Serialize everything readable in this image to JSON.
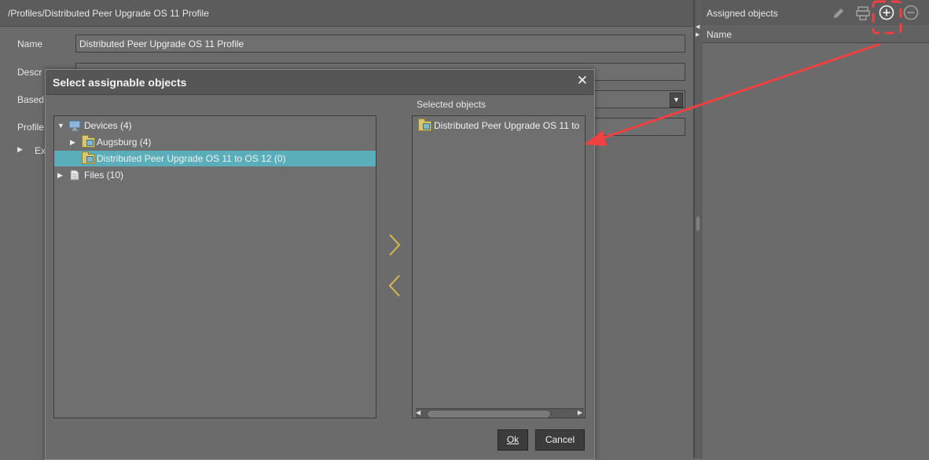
{
  "main": {
    "breadcrumb": "/Profiles/Distributed Peer Upgrade OS 11 Profile",
    "name_label": "Name",
    "name_value": "Distributed Peer Upgrade OS 11 Profile",
    "desc_label": "Descr",
    "based_label": "Based",
    "profile_label": "Profile",
    "extra_label": "Ex"
  },
  "side": {
    "title": "Assigned objects",
    "column_name": "Name",
    "tools": [
      "pencil-icon",
      "printer-icon",
      "plus-circle-icon",
      "minus-circle-icon"
    ]
  },
  "dialog": {
    "title": "Select assignable objects",
    "close": "✕",
    "tree": [
      {
        "label": "Devices (4)",
        "expanded": true
      },
      {
        "label": "Augsburg (4)",
        "expanded": false
      },
      {
        "label": "Distributed Peer Upgrade OS 11 to OS 12  (0)",
        "selected": true
      },
      {
        "label": "Files (10)",
        "expanded": false
      }
    ],
    "selected_label": "Selected objects",
    "selected_items": [
      "Distributed Peer Upgrade OS 11 to"
    ],
    "ok": "Ok",
    "cancel": "Cancel"
  },
  "annotation": {
    "color": "#f04040"
  }
}
